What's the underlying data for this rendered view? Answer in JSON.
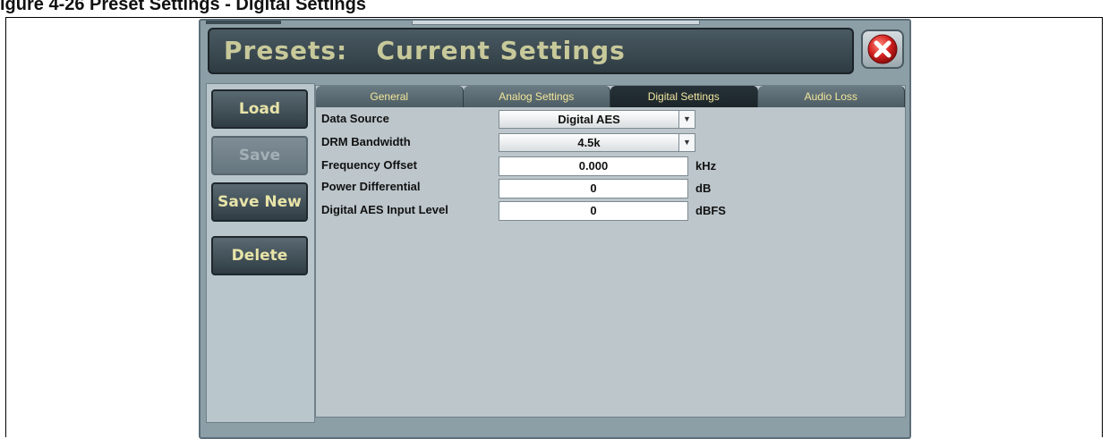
{
  "caption": "igure 4-26 Preset Settings - Digital Settings",
  "title": {
    "screen": "Presets",
    "separator": ":",
    "subtitle": "Current Settings",
    "close_icon": "close-x-icon"
  },
  "side_buttons": {
    "load": "Load",
    "save": "Save",
    "save_new": "Save New",
    "delete": "Delete"
  },
  "tabs": [
    {
      "label": "General",
      "active": false
    },
    {
      "label": "Analog Settings",
      "active": false
    },
    {
      "label": "Digital Settings",
      "active": true
    },
    {
      "label": "Audio Loss",
      "active": false
    }
  ],
  "settings": {
    "data_source": {
      "label": "Data Source",
      "value": "Digital AES"
    },
    "drm_bandwidth": {
      "label": "DRM Bandwidth",
      "value": "4.5k"
    },
    "frequency_offset": {
      "label": "Frequency Offset",
      "value": "0.000",
      "unit": "kHz"
    },
    "power_differential": {
      "label": "Power Differential",
      "value": "0",
      "unit": "dB"
    },
    "aes_input_level": {
      "label": "Digital AES Input Level",
      "value": "0",
      "unit": "dBFS"
    }
  },
  "colors": {
    "accent_text": "#e8e4a8",
    "close_red": "#d32020"
  }
}
